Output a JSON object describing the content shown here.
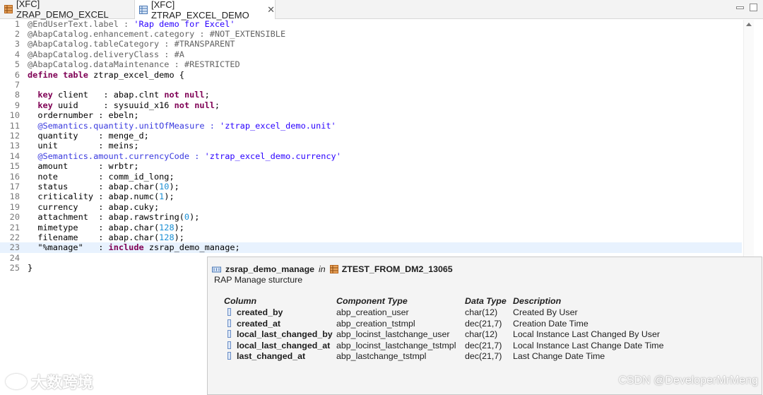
{
  "tabs": [
    {
      "label": "[XFC] ZRAP_DEMO_EXCEL",
      "icon": "table-icon",
      "active": false
    },
    {
      "label": "[XFC] ZTRAP_EXCEL_DEMO",
      "icon": "table-grid-icon",
      "active": true
    }
  ],
  "tab_close_glyph": "✕",
  "code": {
    "lines": [
      {
        "n": "1",
        "tokens": [
          {
            "t": "@EndUserText.label : ",
            "c": "ann"
          },
          {
            "t": "'Rap demo for Excel'",
            "c": "str"
          }
        ]
      },
      {
        "n": "2",
        "tokens": [
          {
            "t": "@AbapCatalog.enhancement.category : #NOT_EXTENSIBLE",
            "c": "ann"
          }
        ]
      },
      {
        "n": "3",
        "tokens": [
          {
            "t": "@AbapCatalog.tableCategory : #TRANSPARENT",
            "c": "ann"
          }
        ]
      },
      {
        "n": "4",
        "tokens": [
          {
            "t": "@AbapCatalog.deliveryClass : #A",
            "c": "ann"
          }
        ]
      },
      {
        "n": "5",
        "tokens": [
          {
            "t": "@AbapCatalog.dataMaintenance : #RESTRICTED",
            "c": "ann"
          }
        ]
      },
      {
        "n": "6",
        "tokens": [
          {
            "t": "define table",
            "c": "kw"
          },
          {
            "t": " ztrap_excel_demo {",
            "c": ""
          }
        ]
      },
      {
        "n": "7",
        "tokens": []
      },
      {
        "n": "8",
        "tokens": [
          {
            "t": "  ",
            "c": ""
          },
          {
            "t": "key",
            "c": "kw"
          },
          {
            "t": " client   : abap.clnt ",
            "c": ""
          },
          {
            "t": "not null",
            "c": "kw"
          },
          {
            "t": ";",
            "c": ""
          }
        ]
      },
      {
        "n": "9",
        "tokens": [
          {
            "t": "  ",
            "c": ""
          },
          {
            "t": "key",
            "c": "kw"
          },
          {
            "t": " uuid     : sysuuid_x16 ",
            "c": ""
          },
          {
            "t": "not null",
            "c": "kw"
          },
          {
            "t": ";",
            "c": ""
          }
        ]
      },
      {
        "n": "10",
        "tokens": [
          {
            "t": "  ordernumber : ebeln;",
            "c": ""
          }
        ]
      },
      {
        "n": "11",
        "tokens": [
          {
            "t": "  @Semantics.quantity.unitOfMeasure : ",
            "c": "blu"
          },
          {
            "t": "'ztrap_excel_demo.unit'",
            "c": "str"
          }
        ]
      },
      {
        "n": "12",
        "tokens": [
          {
            "t": "  quantity    : menge_d;",
            "c": ""
          }
        ]
      },
      {
        "n": "13",
        "tokens": [
          {
            "t": "  unit        : meins;",
            "c": ""
          }
        ]
      },
      {
        "n": "14",
        "tokens": [
          {
            "t": "  @Semantics.amount.currencyCode : ",
            "c": "blu"
          },
          {
            "t": "'ztrap_excel_demo.currency'",
            "c": "str"
          }
        ]
      },
      {
        "n": "15",
        "tokens": [
          {
            "t": "  amount      : wrbtr;",
            "c": ""
          }
        ]
      },
      {
        "n": "16",
        "tokens": [
          {
            "t": "  note        : comm_id_long;",
            "c": ""
          }
        ]
      },
      {
        "n": "17",
        "tokens": [
          {
            "t": "  status      : abap.char(",
            "c": ""
          },
          {
            "t": "10",
            "c": "num"
          },
          {
            "t": ");",
            "c": ""
          }
        ]
      },
      {
        "n": "18",
        "tokens": [
          {
            "t": "  criticality : abap.numc(",
            "c": ""
          },
          {
            "t": "1",
            "c": "num"
          },
          {
            "t": ");",
            "c": ""
          }
        ]
      },
      {
        "n": "19",
        "tokens": [
          {
            "t": "  currency    : abap.cuky;",
            "c": ""
          }
        ]
      },
      {
        "n": "20",
        "tokens": [
          {
            "t": "  attachment  : abap.rawstring(",
            "c": ""
          },
          {
            "t": "0",
            "c": "num"
          },
          {
            "t": ");",
            "c": ""
          }
        ]
      },
      {
        "n": "21",
        "tokens": [
          {
            "t": "  mimetype    : abap.char(",
            "c": ""
          },
          {
            "t": "128",
            "c": "num"
          },
          {
            "t": ");",
            "c": ""
          }
        ]
      },
      {
        "n": "22",
        "tokens": [
          {
            "t": "  filename    : abap.char(",
            "c": ""
          },
          {
            "t": "128",
            "c": "num"
          },
          {
            "t": ");",
            "c": ""
          }
        ]
      },
      {
        "n": "23",
        "tokens": [
          {
            "t": "  \"%manage\"   : ",
            "c": ""
          },
          {
            "t": "include",
            "c": "kw"
          },
          {
            "t": " zsrap_demo_manage;",
            "c": ""
          }
        ],
        "highlight": true
      },
      {
        "n": "24",
        "tokens": []
      },
      {
        "n": "25",
        "tokens": [
          {
            "t": "}",
            "c": ""
          }
        ]
      }
    ]
  },
  "popup": {
    "structure_name": "zsrap_demo_manage",
    "in_label": "in",
    "package": "ZTEST_FROM_DM2_13065",
    "description": "RAP Manage sturcture",
    "headers": {
      "column": "Column",
      "component_type": "Component Type",
      "data_type": "Data Type",
      "description": "Description"
    },
    "rows": [
      {
        "column": "created_by",
        "component_type": "abp_creation_user",
        "data_type": "char(12)",
        "description": "Created By User"
      },
      {
        "column": "created_at",
        "component_type": "abp_creation_tstmpl",
        "data_type": "dec(21,7)",
        "description": "Creation Date Time"
      },
      {
        "column": "local_last_changed_by",
        "component_type": "abp_locinst_lastchange_user",
        "data_type": "char(12)",
        "description": "Local Instance Last Changed By User"
      },
      {
        "column": "local_last_changed_at",
        "component_type": "abp_locinst_lastchange_tstmpl",
        "data_type": "dec(21,7)",
        "description": "Local Instance Last Change Date Time"
      },
      {
        "column": "last_changed_at",
        "component_type": "abp_lastchange_tstmpl",
        "data_type": "dec(21,7)",
        "description": "Last Change Date Time"
      }
    ]
  },
  "watermarks": {
    "left": "大数跨境",
    "right": "CSDN @DeveloperMrMeng"
  }
}
